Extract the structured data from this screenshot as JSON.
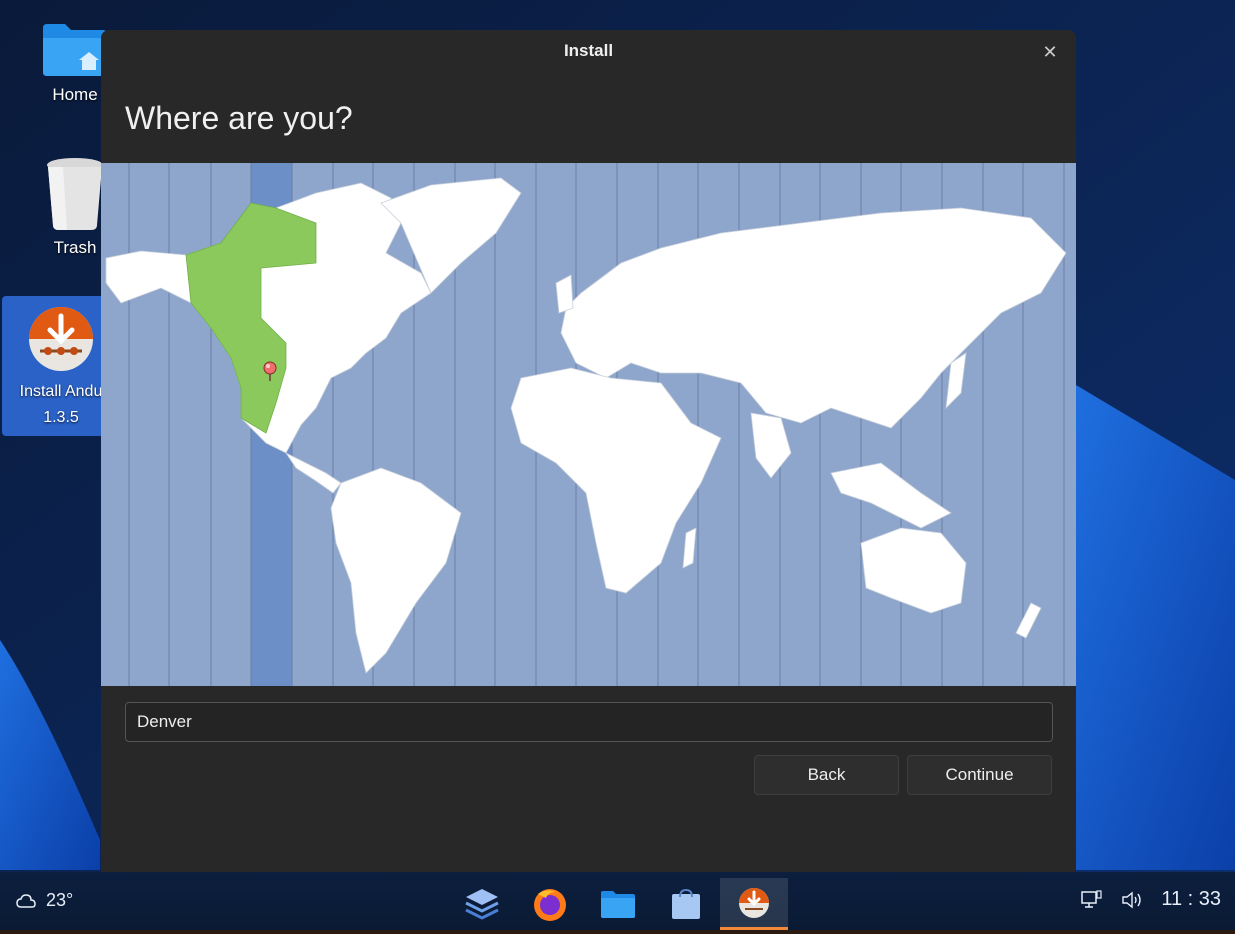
{
  "desktop": {
    "icons": [
      {
        "label": "Home"
      },
      {
        "label": "Trash"
      },
      {
        "label": "Install Andu",
        "label2": "1.3.5"
      }
    ]
  },
  "dialog": {
    "title": "Install",
    "close_icon": "close-icon",
    "heading": "Where are you?",
    "timezone_value": "Denver",
    "selected_timezone_band": "UTC-7",
    "back_label": "Back",
    "continue_label": "Continue"
  },
  "taskbar": {
    "weather_icon": "cloud-icon",
    "weather_temp": "23°",
    "apps": [
      {
        "name": "layers-app",
        "icon": "layers-icon"
      },
      {
        "name": "firefox",
        "icon": "firefox-icon"
      },
      {
        "name": "files",
        "icon": "folder-icon"
      },
      {
        "name": "store",
        "icon": "shopping-bag-icon"
      },
      {
        "name": "installer",
        "icon": "install-icon",
        "active": true
      }
    ],
    "clock": "11 : 33"
  },
  "colors": {
    "dialog_bg": "#282828",
    "ocean": "#8fa6cc",
    "land": "#ffffff",
    "selected_region": "#8cc95c",
    "selected_band": "#6d8fc8",
    "accent": "#f08a3a"
  }
}
